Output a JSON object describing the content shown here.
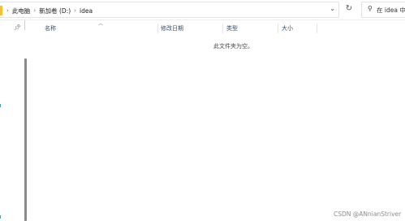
{
  "address": {
    "breadcrumbs": [
      "此电脑",
      "新加卷 (D:)",
      "idea"
    ],
    "separator": ">"
  },
  "search": {
    "placeholder": "在 idea 中"
  },
  "columns": [
    "名称",
    "修改日期",
    "类型",
    "大小"
  ],
  "empty_message": "此文件夹为空。",
  "watermark": "CSDN @ANnianStriver",
  "colors": {
    "folder_accent": "#f2c230",
    "header_text": "#2f4f6f"
  }
}
